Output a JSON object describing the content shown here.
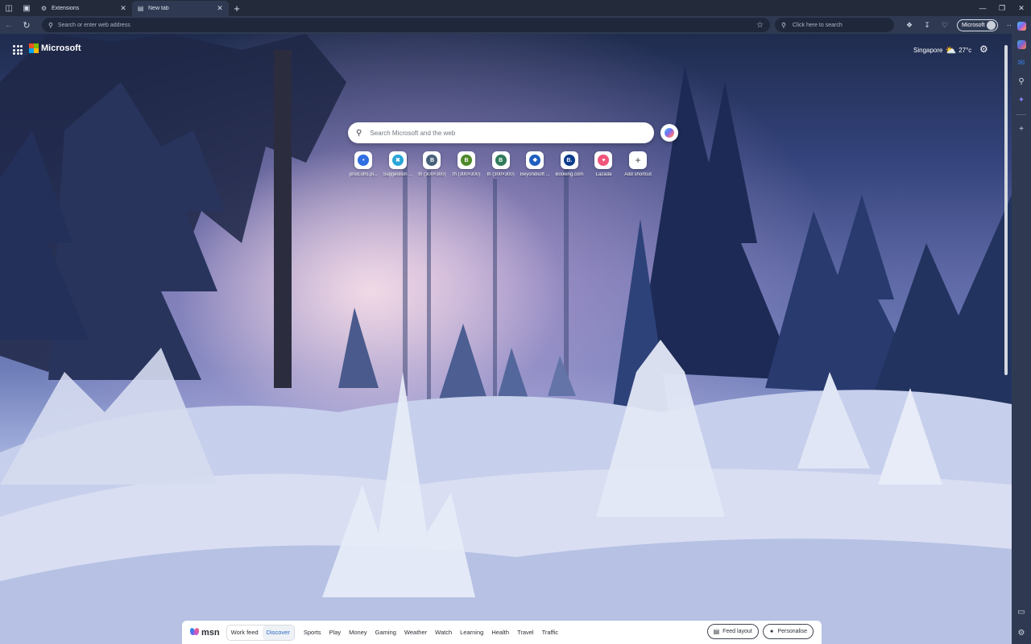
{
  "tabs": [
    {
      "label": "Extensions",
      "icon": "extensions-icon",
      "active": false
    },
    {
      "label": "New tab",
      "icon": "newtab-page-icon",
      "active": true
    }
  ],
  "toolbar": {
    "address_placeholder": "Search or enter web address",
    "search_placeholder": "Click here to search",
    "profile_label": "Microsoft"
  },
  "header": {
    "brand": "Microsoft",
    "location": "Singapore",
    "temperature": "27°c",
    "weather_icon": "partly-cloudy-icon"
  },
  "search": {
    "placeholder": "Search Microsoft and the web"
  },
  "shortcuts": [
    {
      "label": "prod.ufrs.pl...",
      "badge": "•",
      "color": "#2f6ee3"
    },
    {
      "label": "Suggestion ...",
      "badge": "✖",
      "color": "#2aa6d8"
    },
    {
      "label": "th (300×300)",
      "badge": "B",
      "color": "#46607a"
    },
    {
      "label": "th (300×300)",
      "badge": "B",
      "color": "#4f8a2a"
    },
    {
      "label": "th (300×300)",
      "badge": "B",
      "color": "#2f7a5a"
    },
    {
      "label": "Beyondsoft ...",
      "badge": "❖",
      "color": "#1f5fbf"
    },
    {
      "label": "Booking.com",
      "badge": "B.",
      "color": "#0b3b8c"
    },
    {
      "label": "Lazada",
      "badge": "♥",
      "color": "#f2557a"
    },
    {
      "label": "Add shortcut",
      "badge": "+",
      "color": "#ffffff"
    }
  ],
  "msn": {
    "logo_text": "msn",
    "feed_tabs": [
      "Work feed",
      "Discover"
    ],
    "selected_feed": "Discover",
    "nav": [
      "Sports",
      "Play",
      "Money",
      "Gaming",
      "Weather",
      "Watch",
      "Learning",
      "Health",
      "Travel",
      "Traffic"
    ],
    "feed_layout": "Feed layout",
    "personalise": "Personalise"
  }
}
